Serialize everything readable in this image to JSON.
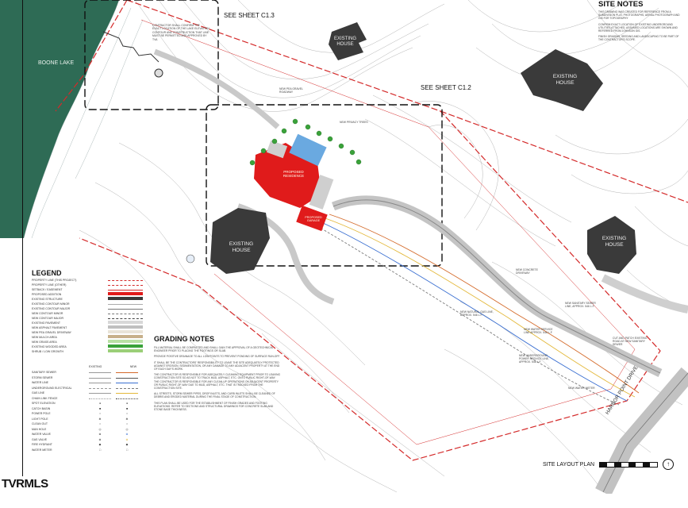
{
  "labels": {
    "boone_lake": "BOONE LAKE",
    "see_sheet_c13": "SEE SHEET C1.3",
    "see_sheet_c12": "SEE SHEET C1.2",
    "existing_house": "EXISTING HOUSE",
    "proposed_house": "PROPOSED RESIDENCE",
    "proposed_garage": "PROPOSED GARAGE",
    "harbor_point_drive": "HARBOR POINT DRIVE",
    "site_layout_plan": "SITE LAYOUT PLAN"
  },
  "site_notes": {
    "title": "SITE NOTES",
    "items": [
      "THIS DRAWING WAS CREATED FOR REFERENCE FROM A SUBDIVISION PLAT, PHOTOGRAPHS, AERIAL PHOTOGRAPH AND GIS FOR TOPOGRAPHY",
      "CONFIRM EXACT LOCATION OF EXISTING UNDERGROUND UTILITIES ATTACHED, ASSUMED LOCATIONS ARE SHOWN AND REFERRED FROM JOHNSON GIS.",
      "FINISH GRADING, SEEDING AND LANDSCAPING TO BE PART OF THE CONTRACTOR'S SCOPE."
    ]
  },
  "grading_notes": {
    "title": "GRADING NOTES",
    "items": [
      "FILL MATERIAL SHALL BE COMPACTED AND SHALL GAIN THE APPROVAL OF A GEOTECHNICAL ENGINEER PRIOR TO PLACING THE FOOTINGS OR SLAB.",
      "PROVIDE POSITIVE DRAINAGE TO ALL LOW POINTS TO PREVENT PONDING OF SURFACE RUN-OFF.",
      "IT SHALL BE THE CONTRACTORS' RESPONSIBILITY TO LEAVE THE SITE ADEQUATELY PROTECTED AGAINST EROSION, SEDIMENTATION, OR ANY DAMAGE TO ANY ADJACENT PROPERTY AT THE END OF EACH DAY'S WORK.",
      "THE CONTRACTOR IS RESPONSIBLE FOR ADEQUATELY CLEANING EQUIPMENT PRIOR TO LEAVING CONSTRUCTION SITE SO AS NOT TO TRACK MUD, ASPHALT, ETC. ONTO PUBLIC RIGHT-OF-WAY. THE CONTRACTOR IS RESPONSIBLE FOR ANY CLEAN-UP OPERATIONS ON ADJACENT PROPERTY OR PUBLIC RIGHT-OF-WAY DUE TO MUD, ASPHALT, ETC. THAT IS TRACKED FROM THE CONSTRUCTION SITE.",
      "ALL STREETS, STORM SEWER PIPES, DROP INLETS, AND CURB INLETS SHALL BE CLEANED OF DEBRIS AND ERODED MATERIAL DURING THE FINAL STAGE OF CONSTRUCTION.",
      "THIS PLAN SHALL BE USED FOR THE ESTABLISHMENT OF FINISH GRADES AND FOOTING ELEVATIONS. REFER TO SECTIONS AND STRUCTURAL DRAWINGS FOR CONCRETE SLAB AND STONE BASE THICKNESS."
    ]
  },
  "legend": {
    "title": "LEGEND",
    "items": [
      "PROPERTY LINE (THIS PROJECT)",
      "PROPERTY LINE (OTHER)",
      "SETBACK / EASEMENT",
      "PROPOSED ADDITION",
      "EXISTING STRUCTURE",
      "EXISTING CONTOUR MINOR",
      "EXISTING CONTOUR MAJOR",
      "NEW CONTOUR MINOR",
      "NEW CONTOUR MAJOR",
      "EXISTING PAVEMENT",
      "NEW ASPHALT PAVEMENT",
      "NEW PEA GRAVEL DRIVEWAY",
      "NEW MULCH AREA",
      "NEW GRASS AREA",
      "EXISTING WOODED AREA",
      "SHRUB / LOW GROWTH"
    ],
    "col_existing": "EXISTING",
    "col_new": "NEW",
    "utilities": [
      "SANITARY SEWER",
      "STORM SEWER",
      "WATER LINE",
      "UNDERGROUND ELECTRICAL",
      "GAS LINE",
      "CHAIN LINK FENCE",
      "SPOT ELEVATION",
      "CATCH BASIN",
      "POWER POLE",
      "LIGHT POLE",
      "CLEAN OUT",
      "MAN HOLE",
      "WATER VALVE",
      "GAS VALVE",
      "FIRE HYDRANT",
      "WATER METER"
    ]
  },
  "callouts": {
    "new_pea_gravel": "NEW PEA GRAVEL ROADWAY",
    "new_privacy_trees": "NEW PRIVACY TREES",
    "new_concrete_driveway": "NEW CONCRETE DRIVEWAY",
    "new_natural_gas": "NEW NATURAL GAS LINE, APPROX. 546 L.F.",
    "new_sanitary": "NEW SANITARY SEWER LINE, APPROX. 546 L.F.",
    "new_water": "NEW WATER SERVICE LINE APPROX. 546 L.F.",
    "new_power": "NEW UNDERGROUND POWER SERVICE LINE, APPROX. 546 L.F.",
    "new_water_meter": "NEW WATER METER",
    "cut_and_patch": "CUT AND PATCH EXISTING ROAD AT NEW SANITARY SEWER",
    "confirm_note": "CONTRACTOR SHALL CONFIRM THE EXACT LOCATION OF THE LAKE ELEVATION CONTOUR AND CONSTRUCTION THAT LINE MUST BE PERMITTED AND APPROVED BY TVA"
  },
  "watermark": "TVRMLS",
  "colors": {
    "lake": "#2e6b55",
    "house": "#3a3a3a",
    "proposed": "#e01b1b",
    "property_line": "#d42a2a",
    "road": "#bdbdbd",
    "trees": "#3aa23a"
  }
}
